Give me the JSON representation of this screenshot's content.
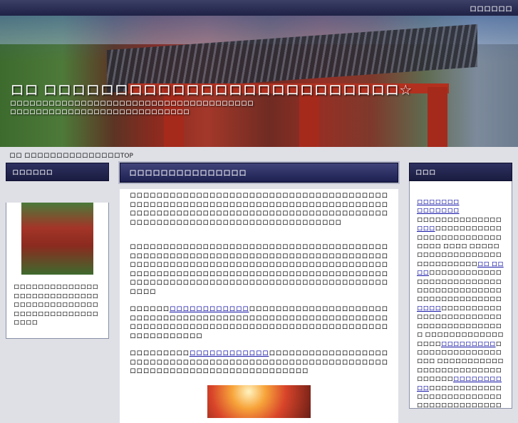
{
  "topbar": {
    "right_text": "ロロロロロロ"
  },
  "header": {
    "title": "ロロ ロロロロロロロロロロロロロロロロロロロロロロロロロ☆",
    "description": "ロロロロロロロロロロロロロロロロロロロロロロロロロロロロロロロロロロロロロロロロロロロロロロロロロロロロロロロロロロロロロロロロロロ"
  },
  "breadcrumb": "ロロ ロロロロロロロロロロロロロロロTOP",
  "left": {
    "heading": "ロロロロロロ",
    "text": "ロロロロロロロロロロロロロロロロロロロロロロロロロロロロロロロロロロロロロロロロロロロロロロロロロロロロロロロロロロロロ"
  },
  "main": {
    "title": "ロロロロロロロロロロロロロロロ",
    "p1": "ロロロロロロロロロロロロロロロロロロロロロロロロロロロロロロロロロロロロロロロロロロロロロロロロロロロロロロロロロロロロロロロロロロロロロロロロロロロロロロロロロロロロロロロロロロロロロロロロロロロロロロロロロロロロロロロロロロロロロロロロロロロロロロロロロロロロロロロロロロロロロロロロロロロロロ",
    "p2": "ロロロロロロロロロロロロロロロロロロロロロロロロロロロロロロロロロロロロロロロロロロロロロロロロロロロロロロロロロロロロロロロロロロロロロロロロロロロロロロロロロロロロロロロロロロロロロロロロロロロロロロロロロロロロロロロロロロロロロロロロロロロロロロロロロロロロロロロロロロロロロロロロロロロロロロロロロロロロロロロロロロロロロロロロロロロロロロロロロロロロロロロロロロロロロロロロロロロロロロロ",
    "p3_pre": "ロロロロロロ",
    "p3_link": "ロロロロロロロロロロロロ",
    "p3_post": "ロロロロロロロロロロロロロロロロロロロロロロロロロロロロロロロロロロロロロロロロロロロロロロロロロロロロロロロロロロロロロロロロロロロロロロロロロロロロロロロロロロロロロロロロロロロロロロロロロロロロロロロロロロロロロロ",
    "p4_pre": "ロロロロロロロロロ",
    "p4_link": "ロロロロロロロロロロロロ",
    "p4_post": "ロロロロロロロロロロロロロロロロロロロロロロロロロロロロロロロロロロロロロロロロロロロロロロロロロロロロロロロロロロロロロロロロロロロロロロロロロロロロロロロロロロロロ"
  },
  "right": {
    "heading": "ロロロ",
    "link1": "ロロロロロロロ",
    "link2": "ロロロロロロロ",
    "t1": "ロロロロロロロロロロロロロロ",
    "l3": "ロロロ",
    "t2": "ロロロロロロロロロロロロロロロロロロロロロロロロロロロロロ ロロロロ ロロロロロロロロロロロロロロロロロロロロロロロロロロロロロ",
    "l4": "ロロ ロロロロ",
    "t3": "ロロロロロロロロロロロロロロロロロロロロロロロロロロロロロロロロロロロロロロロロロロロロロロロロロロロロロロ",
    "l5": "ロロロロ",
    "t4": "ロロロロロロロロロロロロロロロロロロロロロロロロロロロロロロロロロロロロロロロ ロロロロロロロロロロロロロロロロロ",
    "l6": "ロロロロロロロロロ",
    "t5": "ロロロロロロロロロロロロロロロロロロ ロロロロロロロロロロロロロロロロロロロロロロロロロロロロロロロ",
    "l7": "ロロロロロロロロロロ",
    "t6": "ロロロロロロロロロロロロロロロロロロロロロロロロロロロロロロロロロロロロロロロロロロロロロロロロロ"
  }
}
